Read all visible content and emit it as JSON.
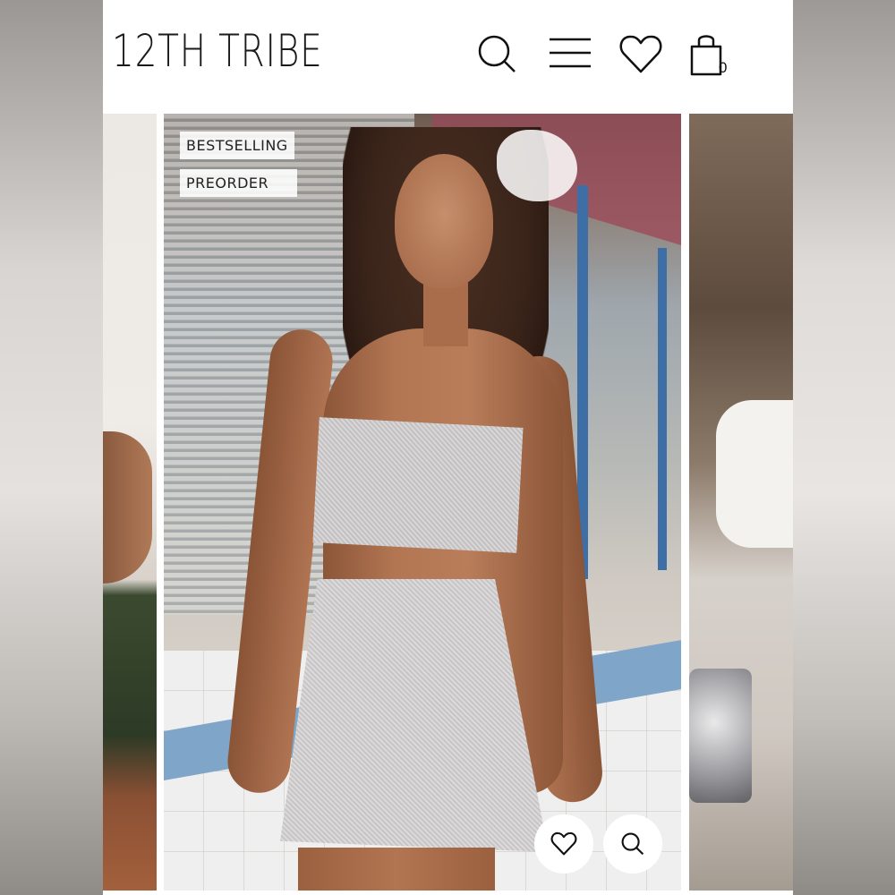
{
  "header": {
    "logo_text": "12TH TRIBE",
    "icons": [
      "search-icon",
      "menu-icon",
      "heart-icon",
      "bag-icon"
    ],
    "cart_count": "0"
  },
  "product": {
    "badges": [
      "BESTSELLING",
      "PREORDER"
    ],
    "actions": [
      "heart-icon",
      "search-icon"
    ]
  },
  "colors": {
    "background": "#ffffff",
    "text": "#1a1a1a",
    "badge_bg": "#ffffff"
  }
}
